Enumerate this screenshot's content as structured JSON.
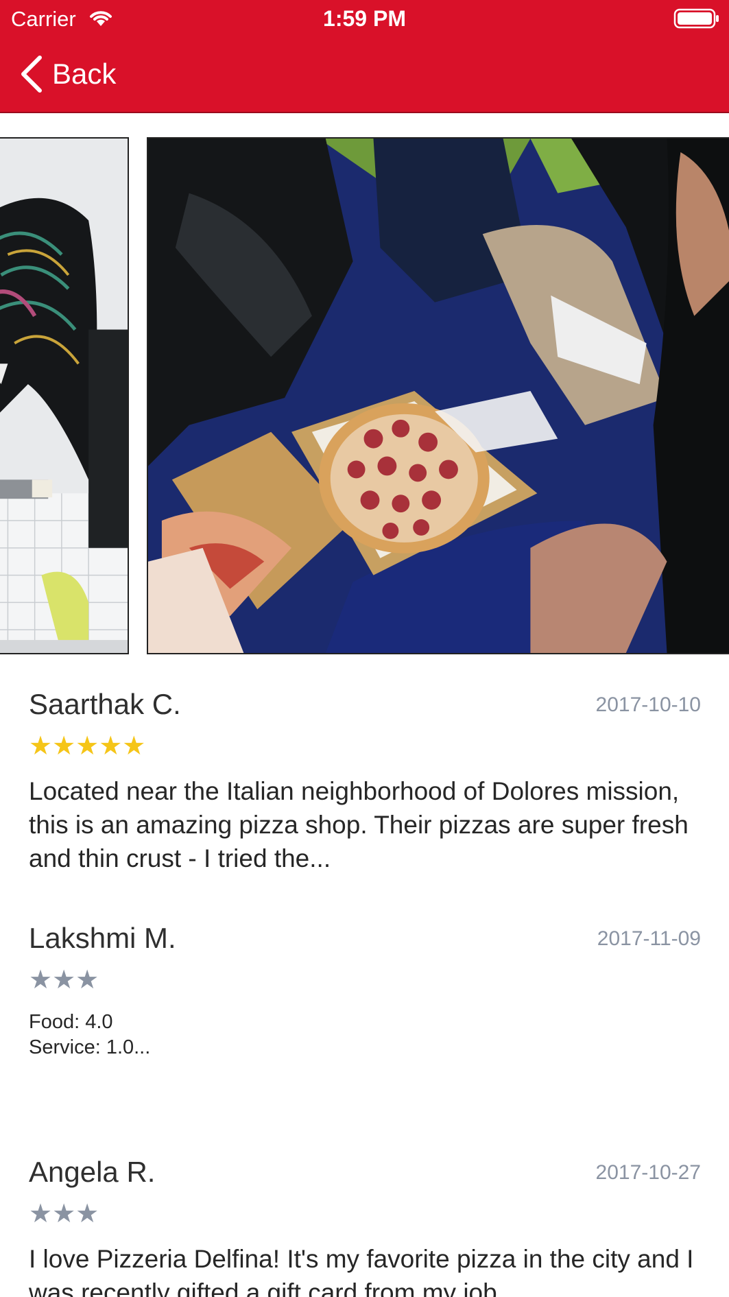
{
  "status_bar": {
    "carrier": "Carrier",
    "time": "1:59 PM"
  },
  "nav": {
    "back_label": "Back"
  },
  "colors": {
    "header_red": "#d91129",
    "star_gold": "#f5c518",
    "star_grey": "#8a93a2"
  },
  "reviews": [
    {
      "name": "Saarthak C.",
      "date": "2017-10-10",
      "stars": "★★★★★",
      "rating": 5,
      "text": "Located near the Italian neighborhood of Dolores mission, this is an amazing pizza shop. Their pizzas are super fresh and thin crust - I tried the..."
    },
    {
      "name": "Lakshmi M.",
      "date": "2017-11-09",
      "stars": "★★★",
      "rating": 3,
      "text": "Food: 4.0\nService: 1.0..."
    },
    {
      "name": "Angela R.",
      "date": "2017-10-27",
      "stars": "★★★",
      "rating": 3,
      "text": "I love Pizzeria Delfina! It's my favorite pizza in the city and I was recently gifted a gift card from my job"
    }
  ]
}
